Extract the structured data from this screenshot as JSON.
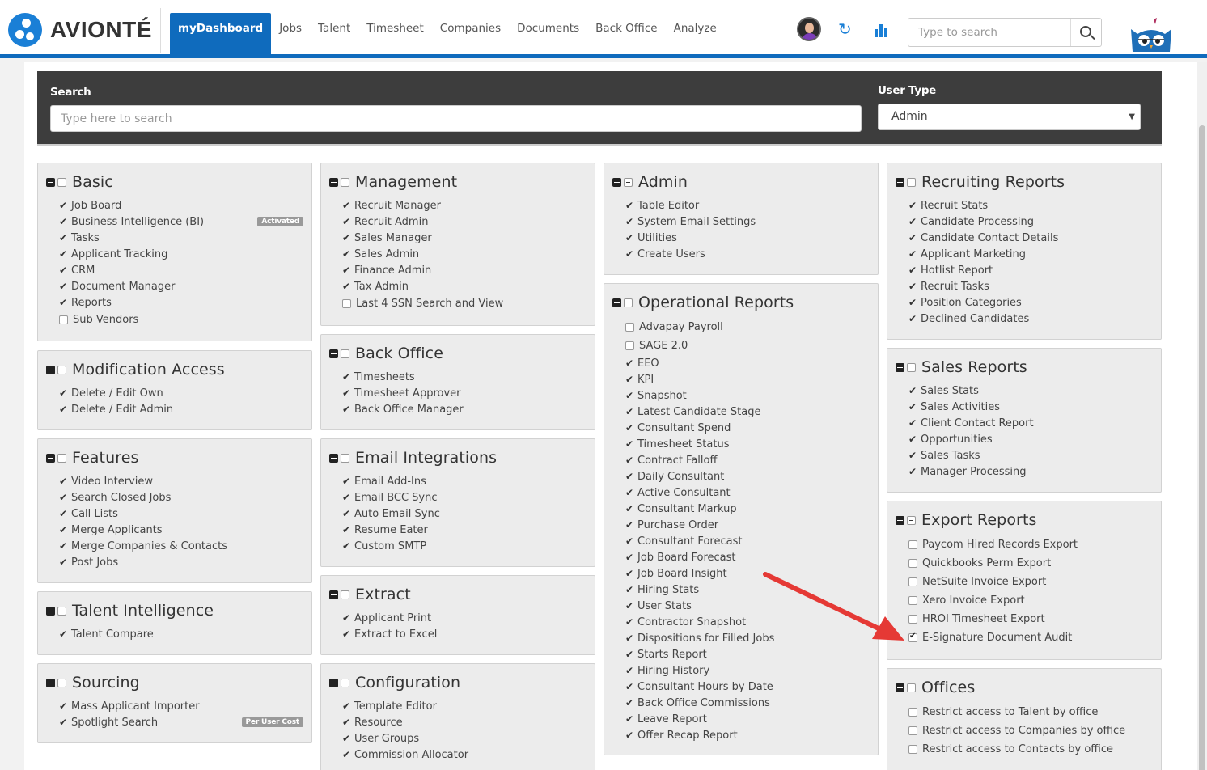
{
  "brand": {
    "name": "AVIONTÉ"
  },
  "nav": {
    "tabs": [
      "myDashboard",
      "Jobs",
      "Talent",
      "Timesheet",
      "Companies",
      "Documents",
      "Back Office",
      "Analyze"
    ],
    "search_placeholder": "Type to search",
    "icons": [
      "avatar",
      "refresh-icon",
      "bar-chart-icon",
      "search-icon",
      "owl-mascot"
    ]
  },
  "colors": {
    "accent": "#0f6bbd",
    "filter_bg": "#3d3d3d",
    "panel_bg": "#ececec",
    "arrow": "#e53935"
  },
  "filter": {
    "search_label": "Search",
    "search_placeholder": "Type here to search",
    "usertype_label": "User Type",
    "usertype_value": "Admin"
  },
  "panels": {
    "basic": {
      "title": "Basic",
      "items": [
        {
          "label": "Job Board",
          "state": "check"
        },
        {
          "label": "Business Intelligence (BI)",
          "state": "check",
          "badge": "Activated"
        },
        {
          "label": "Tasks",
          "state": "check"
        },
        {
          "label": "Applicant Tracking",
          "state": "check"
        },
        {
          "label": "CRM",
          "state": "check"
        },
        {
          "label": "Document Manager",
          "state": "check"
        },
        {
          "label": "Reports",
          "state": "check"
        },
        {
          "label": "Sub Vendors",
          "state": "unchecked"
        }
      ]
    },
    "modification": {
      "title": "Modification Access",
      "items": [
        {
          "label": "Delete / Edit Own",
          "state": "check"
        },
        {
          "label": "Delete / Edit Admin",
          "state": "check"
        }
      ]
    },
    "features": {
      "title": "Features",
      "items": [
        {
          "label": "Video Interview",
          "state": "check"
        },
        {
          "label": "Search Closed Jobs",
          "state": "check"
        },
        {
          "label": "Call Lists",
          "state": "check"
        },
        {
          "label": "Merge Applicants",
          "state": "check"
        },
        {
          "label": "Merge Companies & Contacts",
          "state": "check"
        },
        {
          "label": "Post Jobs",
          "state": "check"
        }
      ]
    },
    "talent_intel": {
      "title": "Talent Intelligence",
      "items": [
        {
          "label": "Talent Compare",
          "state": "check"
        }
      ]
    },
    "sourcing": {
      "title": "Sourcing",
      "items": [
        {
          "label": "Mass Applicant Importer",
          "state": "check"
        },
        {
          "label": "Spotlight Search",
          "state": "check",
          "badge": "Per User Cost"
        }
      ]
    },
    "management": {
      "title": "Management",
      "items": [
        {
          "label": "Recruit Manager",
          "state": "check"
        },
        {
          "label": "Recruit Admin",
          "state": "check"
        },
        {
          "label": "Sales Manager",
          "state": "check"
        },
        {
          "label": "Sales Admin",
          "state": "check"
        },
        {
          "label": "Finance Admin",
          "state": "check"
        },
        {
          "label": "Tax Admin",
          "state": "check"
        },
        {
          "label": "Last 4 SSN Search and View",
          "state": "unchecked"
        }
      ]
    },
    "backoffice": {
      "title": "Back Office",
      "items": [
        {
          "label": "Timesheets",
          "state": "check"
        },
        {
          "label": "Timesheet Approver",
          "state": "check"
        },
        {
          "label": "Back Office Manager",
          "state": "check"
        }
      ]
    },
    "email": {
      "title": "Email Integrations",
      "items": [
        {
          "label": "Email Add-Ins",
          "state": "check"
        },
        {
          "label": "Email BCC Sync",
          "state": "check"
        },
        {
          "label": "Auto Email Sync",
          "state": "check"
        },
        {
          "label": "Resume Eater",
          "state": "check"
        },
        {
          "label": "Custom SMTP",
          "state": "check"
        }
      ]
    },
    "extract": {
      "title": "Extract",
      "items": [
        {
          "label": "Applicant Print",
          "state": "check"
        },
        {
          "label": "Extract to Excel",
          "state": "check"
        }
      ]
    },
    "configuration": {
      "title": "Configuration",
      "items": [
        {
          "label": "Template Editor",
          "state": "check"
        },
        {
          "label": "Resource",
          "state": "check"
        },
        {
          "label": "User Groups",
          "state": "check"
        },
        {
          "label": "Commission Allocator",
          "state": "check"
        }
      ]
    },
    "admin": {
      "title": "Admin",
      "items": [
        {
          "label": "Table Editor",
          "state": "check"
        },
        {
          "label": "System Email Settings",
          "state": "check"
        },
        {
          "label": "Utilities",
          "state": "check"
        },
        {
          "label": "Create Users",
          "state": "check"
        }
      ]
    },
    "operational": {
      "title": "Operational Reports",
      "items": [
        {
          "label": "Advapay Payroll",
          "state": "unchecked"
        },
        {
          "label": "SAGE 2.0",
          "state": "unchecked"
        },
        {
          "label": "EEO",
          "state": "check"
        },
        {
          "label": "KPI",
          "state": "check"
        },
        {
          "label": "Snapshot",
          "state": "check"
        },
        {
          "label": "Latest Candidate Stage",
          "state": "check"
        },
        {
          "label": "Consultant Spend",
          "state": "check"
        },
        {
          "label": "Timesheet Status",
          "state": "check"
        },
        {
          "label": "Contract Falloff",
          "state": "check"
        },
        {
          "label": "Daily Consultant",
          "state": "check"
        },
        {
          "label": "Active Consultant",
          "state": "check"
        },
        {
          "label": "Consultant Markup",
          "state": "check"
        },
        {
          "label": "Purchase Order",
          "state": "check"
        },
        {
          "label": "Consultant Forecast",
          "state": "check"
        },
        {
          "label": "Job Board Forecast",
          "state": "check"
        },
        {
          "label": "Job Board Insight",
          "state": "check"
        },
        {
          "label": "Hiring Stats",
          "state": "check"
        },
        {
          "label": "User Stats",
          "state": "check"
        },
        {
          "label": "Contractor Snapshot",
          "state": "check"
        },
        {
          "label": "Dispositions for Filled Jobs",
          "state": "check"
        },
        {
          "label": "Starts Report",
          "state": "check"
        },
        {
          "label": "Hiring History",
          "state": "check"
        },
        {
          "label": "Consultant Hours by Date",
          "state": "check"
        },
        {
          "label": "Back Office Commissions",
          "state": "check"
        },
        {
          "label": "Leave Report",
          "state": "check"
        },
        {
          "label": "Offer Recap Report",
          "state": "check"
        }
      ]
    },
    "recruiting": {
      "title": "Recruiting Reports",
      "items": [
        {
          "label": "Recruit Stats",
          "state": "check"
        },
        {
          "label": "Candidate Processing",
          "state": "check"
        },
        {
          "label": "Candidate Contact Details",
          "state": "check"
        },
        {
          "label": "Applicant Marketing",
          "state": "check"
        },
        {
          "label": "Hotlist Report",
          "state": "check"
        },
        {
          "label": "Recruit Tasks",
          "state": "check"
        },
        {
          "label": "Position Categories",
          "state": "check"
        },
        {
          "label": "Declined Candidates",
          "state": "check"
        }
      ]
    },
    "sales": {
      "title": "Sales Reports",
      "items": [
        {
          "label": "Sales Stats",
          "state": "check"
        },
        {
          "label": "Sales Activities",
          "state": "check"
        },
        {
          "label": "Client Contact Report",
          "state": "check"
        },
        {
          "label": "Opportunities",
          "state": "check"
        },
        {
          "label": "Sales Tasks",
          "state": "check"
        },
        {
          "label": "Manager Processing",
          "state": "check"
        }
      ]
    },
    "export": {
      "title": "Export Reports",
      "items": [
        {
          "label": "Paycom Hired Records Export",
          "state": "unchecked"
        },
        {
          "label": "Quickbooks Perm Export",
          "state": "unchecked"
        },
        {
          "label": "NetSuite Invoice Export",
          "state": "unchecked"
        },
        {
          "label": "Xero Invoice Export",
          "state": "unchecked"
        },
        {
          "label": "HROI Timesheet Export",
          "state": "unchecked"
        },
        {
          "label": "E-Signature Document Audit",
          "state": "checked"
        }
      ]
    },
    "offices": {
      "title": "Offices",
      "items": [
        {
          "label": "Restrict access to Talent by office",
          "state": "unchecked"
        },
        {
          "label": "Restrict access to Companies by office",
          "state": "unchecked"
        },
        {
          "label": "Restrict access to Contacts by office",
          "state": "unchecked"
        }
      ]
    }
  }
}
